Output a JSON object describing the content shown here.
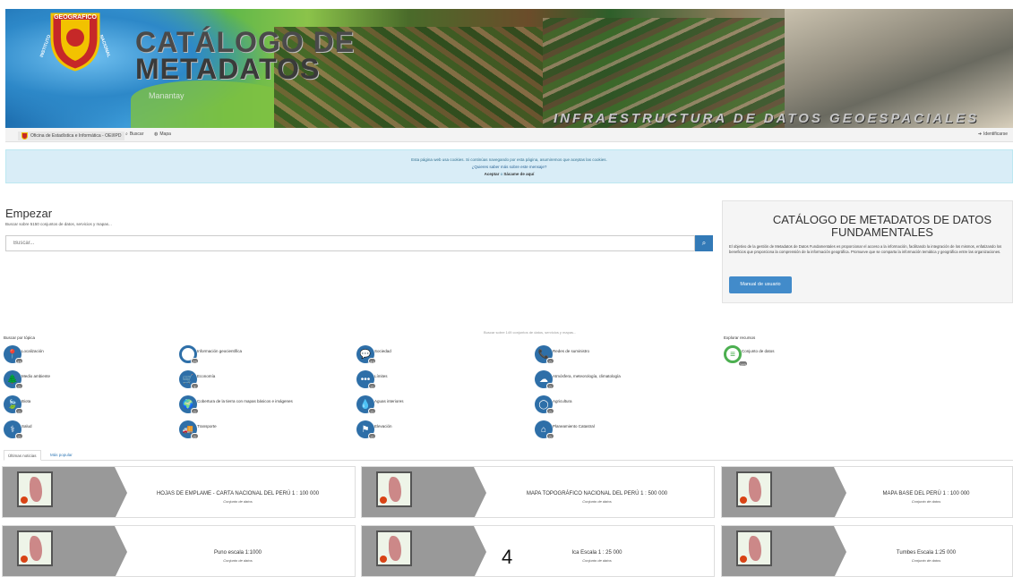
{
  "banner": {
    "title_line1": "CATÁLOGO DE",
    "title_line2": "METADATOS",
    "subtitle": "INFRAESTRUCTURA DE DATOS GEOESPACIALES",
    "place": "Manantay",
    "logo_top": "GEOGRAFICO",
    "logo_left": "INSTITUTO",
    "logo_right": "NACIONAL"
  },
  "navbar": {
    "brand": "Oficina de Estadística e Informática - OEI/IPD",
    "search": "Buscar",
    "maps": "Mapa",
    "login": "Identificarse"
  },
  "cookie": {
    "line1": "Esta página web usa cookies. Si continúas navegando por esta página, asumiremos que aceptas las cookies.",
    "line2": "¿Quieres saber más sobre este mensaje?",
    "accept": "Aceptar",
    "or": "o",
    "leave": "Sácame de aquí"
  },
  "start": {
    "heading": "Empezar",
    "subtext": "Buscar sobre 5150 conjuntos de datos, servicios y mapas...",
    "search_placeholder": "Buscar..."
  },
  "panel": {
    "title": "CATÁLOGO DE METADATOS DE DATOS FUNDAMENTALES",
    "body": "El objetivo de la gestión de Metadatos de Datos Fundamentales es proporcionar el acceso a la información, facilitando la integración de los mismos, enfatizando los beneficios que proporciona la comprensión de la información geográfica. Promueve que se comparta la información temática y geográfica entre las organizaciones.",
    "button": "Manual de usuario"
  },
  "count_line": "Buscar sobre 149 conjuntos de datos, servicios y mapas...",
  "topics_label": "Buscar por tópica",
  "explore_label": "Explorar recursos",
  "topics": [
    {
      "label": "Localización",
      "count": "48",
      "icon": "location-pin-icon",
      "glyph": "📍"
    },
    {
      "label": "Información geocientífica",
      "count": "23",
      "icon": "target-icon",
      "glyph": "◎"
    },
    {
      "label": "Sociedad",
      "count": "44",
      "icon": "chat-bubbles-icon",
      "glyph": "💬"
    },
    {
      "label": "Redes de suministro",
      "count": "0",
      "icon": "phone-icon",
      "glyph": "📞"
    },
    {
      "label": "Medio ambiente",
      "count": "0",
      "icon": "tree-icon",
      "glyph": "🌲"
    },
    {
      "label": "Economía",
      "count": "4",
      "icon": "cart-icon",
      "glyph": "🛒"
    },
    {
      "label": "Límites",
      "count": "0",
      "icon": "dots-icon",
      "glyph": "•••"
    },
    {
      "label": "Atmósfera, meteorología, climatología",
      "count": "0",
      "icon": "cloud-icon",
      "glyph": "☁"
    },
    {
      "label": "Biota",
      "count": "0",
      "icon": "leaf-icon",
      "glyph": "🍃"
    },
    {
      "label": "Cobertura de la tierra con mapas básicos e imágenes",
      "count": "0",
      "icon": "globe-icon",
      "glyph": "🌍"
    },
    {
      "label": "Aguas interiores",
      "count": "0",
      "icon": "droplet-icon",
      "glyph": "💧"
    },
    {
      "label": "Agricultura",
      "count": "0",
      "icon": "seed-icon",
      "glyph": "◯"
    },
    {
      "label": "Salud",
      "count": "0",
      "icon": "stethoscope-icon",
      "glyph": "⚕"
    },
    {
      "label": "Transporte",
      "count": "0",
      "icon": "truck-icon",
      "glyph": "🚚"
    },
    {
      "label": "Elevación",
      "count": "0",
      "icon": "flag-icon",
      "glyph": "⚑"
    },
    {
      "label": "Planeamiento Catastral",
      "count": "0",
      "icon": "home-icon",
      "glyph": "⌂"
    }
  ],
  "explore": {
    "label": "Conjunto de datos",
    "count": "149",
    "icon": "database-icon",
    "glyph": "≡"
  },
  "tabs": {
    "latest": "Últimas noticias",
    "popular": "Más popular"
  },
  "cards": [
    {
      "title": "HOJAS DE EMPLAME - CARTA NACIONAL DEL PERÚ 1 : 100 000",
      "type": "Conjunto de datos"
    },
    {
      "title": "MAPA TOPOGRÁFICO NACIONAL DEL PERÚ 1 : 500 000",
      "type": "Conjunto de datos"
    },
    {
      "title": "MAPA BASE DEL PERÚ 1 : 100 000",
      "type": "Conjunto de datos"
    },
    {
      "title": "Puno escala 1:1000",
      "type": "Conjunto de datos"
    },
    {
      "title": "Ica Escala 1 : 25 000",
      "type": "Conjunto de datos"
    },
    {
      "title": "Tumbes Escala 1:25 000",
      "type": "Conjunto de datos"
    }
  ],
  "page_number": "4"
}
